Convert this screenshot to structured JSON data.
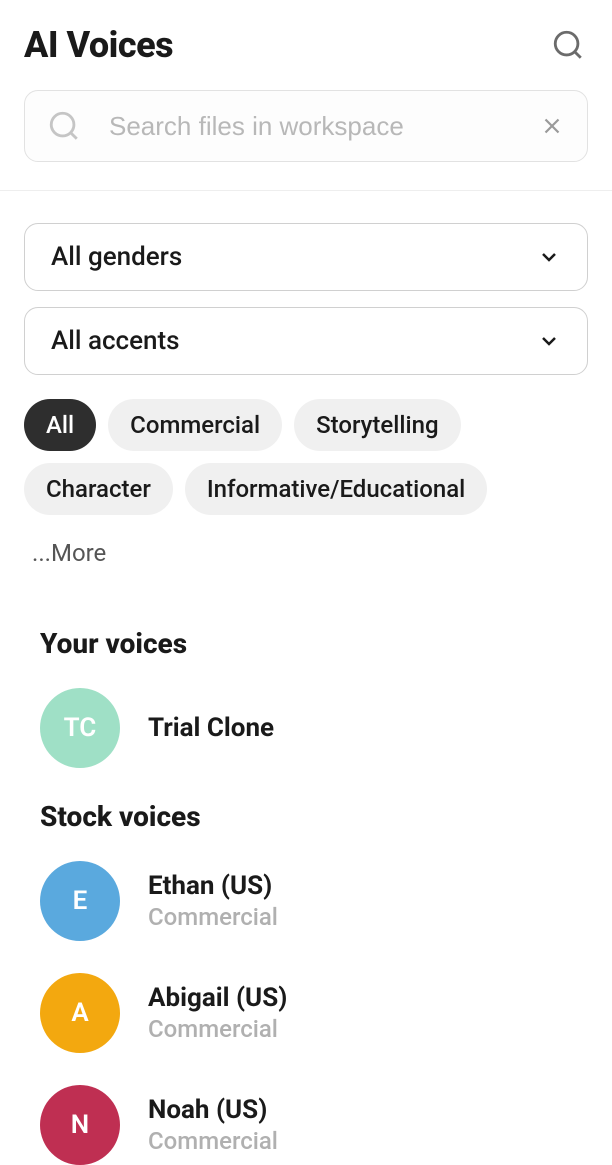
{
  "header": {
    "title": "AI Voices"
  },
  "search": {
    "placeholder": "Search files in workspace",
    "value": ""
  },
  "filters": {
    "gender": {
      "selected": "All genders"
    },
    "accent": {
      "selected": "All accents"
    }
  },
  "chips": [
    {
      "label": "All",
      "active": true
    },
    {
      "label": "Commercial",
      "active": false
    },
    {
      "label": "Storytelling",
      "active": false
    },
    {
      "label": "Character",
      "active": false
    },
    {
      "label": "Informative/Educational",
      "active": false
    }
  ],
  "more_label": "...More",
  "sections": {
    "your_voices": {
      "title": "Your voices",
      "items": [
        {
          "initials": "TC",
          "name": "Trial Clone",
          "category": "",
          "bg": "#9fe0c6",
          "fg": "#ffffff"
        }
      ]
    },
    "stock_voices": {
      "title": "Stock voices",
      "items": [
        {
          "initials": "E",
          "name": "Ethan (US)",
          "category": "Commercial",
          "bg": "#5aa9de",
          "fg": "#ffffff"
        },
        {
          "initials": "A",
          "name": "Abigail (US)",
          "category": "Commercial",
          "bg": "#f3a80f",
          "fg": "#ffffff"
        },
        {
          "initials": "N",
          "name": "Noah (US)",
          "category": "Commercial",
          "bg": "#bf2f52",
          "fg": "#ffffff"
        }
      ]
    }
  }
}
